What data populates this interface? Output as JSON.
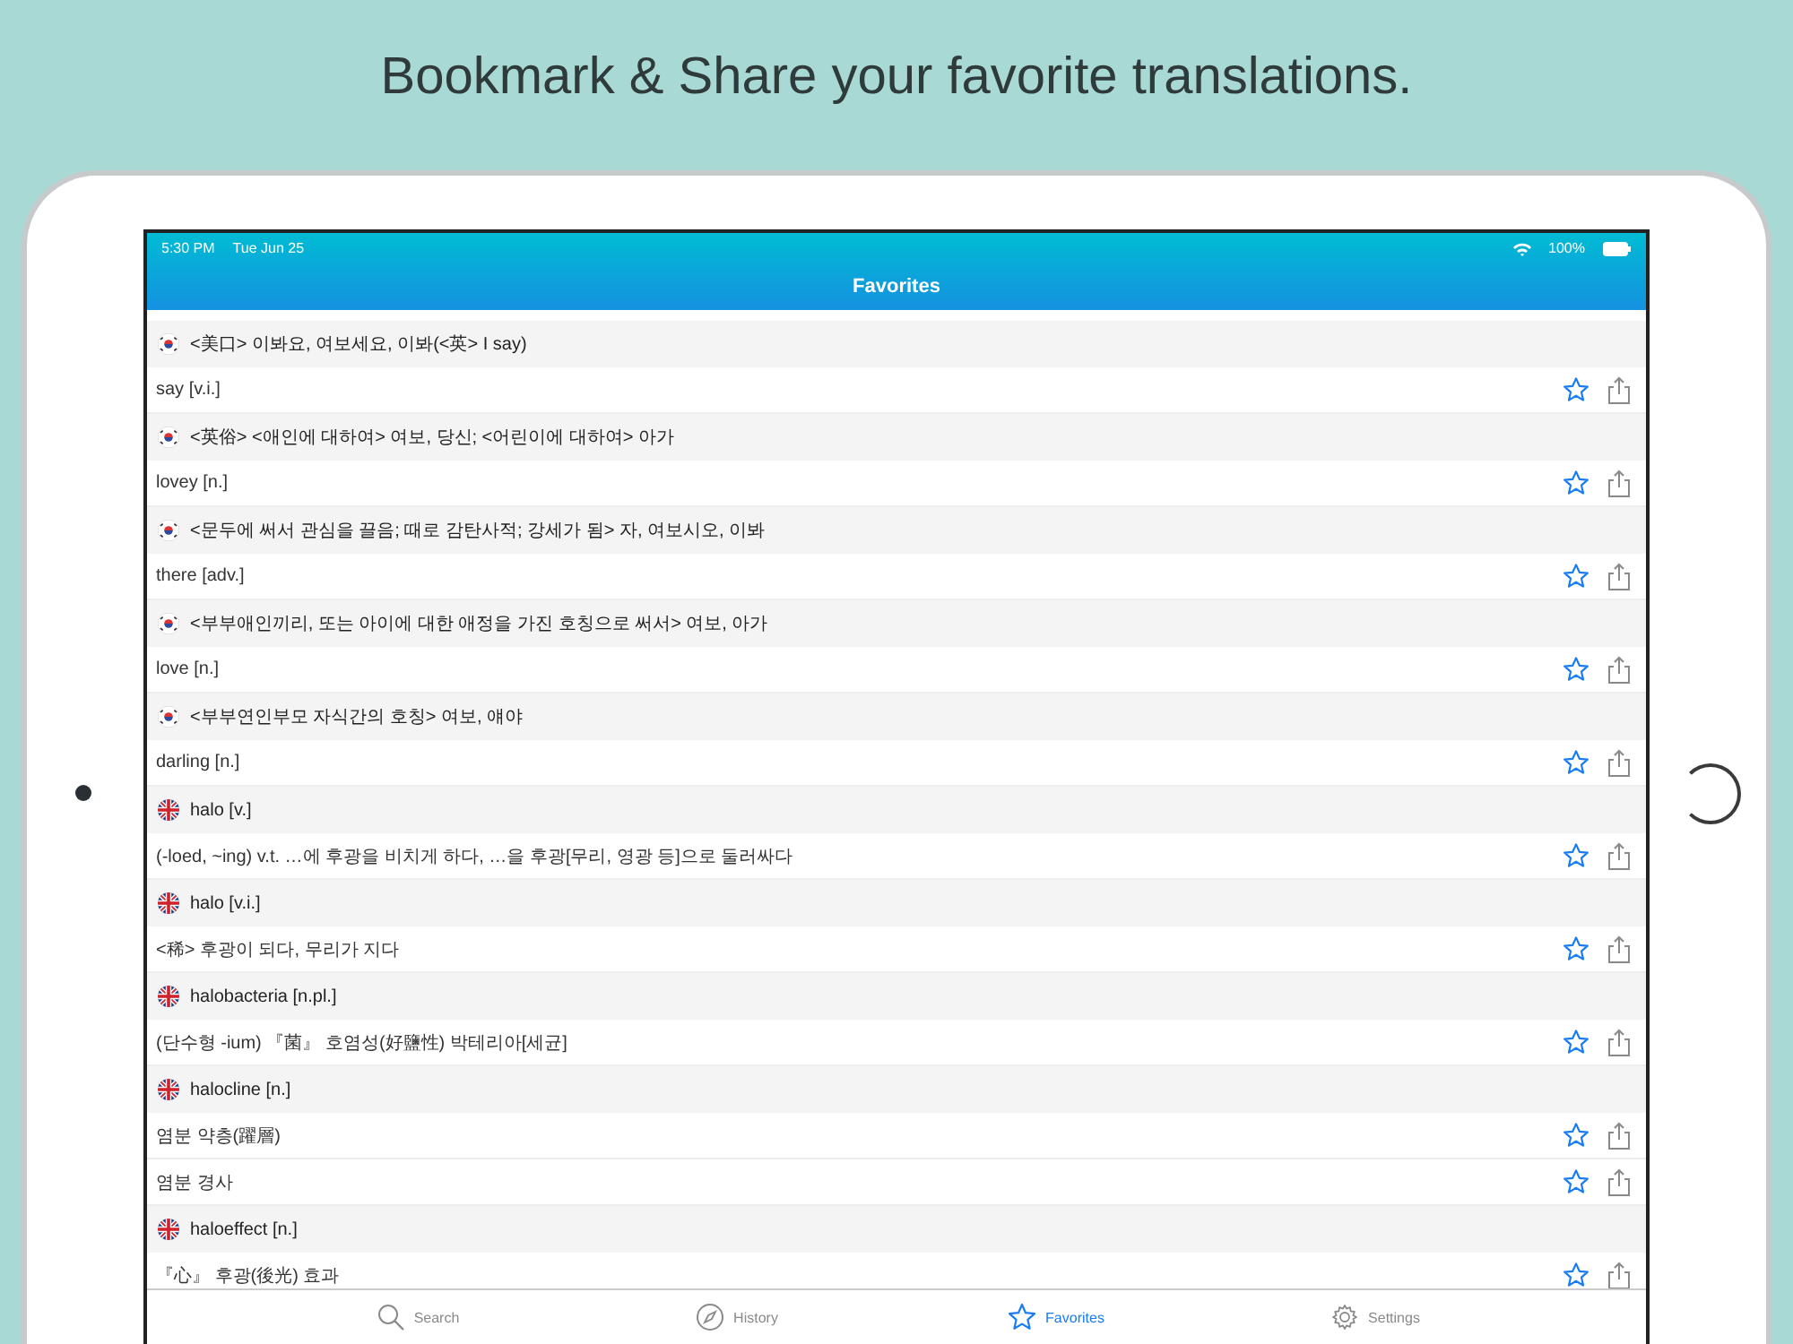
{
  "headline": "Bookmark & Share your favorite translations.",
  "status_bar": {
    "time": "5:30 PM",
    "date": "Tue Jun 25",
    "battery": "100%"
  },
  "nav_title": "Favorites",
  "groups": [
    {
      "kind": "korean",
      "heading": "<美口> 이봐요, 여보세요, 이봐(<英> I say)",
      "entries": [
        "say [v.i.]"
      ]
    },
    {
      "kind": "korean",
      "heading": "<英俗> <애인에 대하여> 여보, 당신; <어린이에 대하여> 아가",
      "entries": [
        "lovey [n.]"
      ]
    },
    {
      "kind": "korean",
      "heading": "<문두에 써서 관심을 끌음; 때로 감탄사적; 강세가 됨> 자, 여보시오, 이봐",
      "entries": [
        "there [adv.]"
      ]
    },
    {
      "kind": "korean",
      "heading": "<부부애인끼리, 또는 아이에 대한 애정을 가진 호칭으로 써서> 여보, 아가",
      "entries": [
        "love [n.]"
      ]
    },
    {
      "kind": "korean",
      "heading": "<부부연인부모 자식간의 호칭> 여보, 얘야",
      "entries": [
        "darling [n.]"
      ]
    },
    {
      "kind": "british",
      "heading": "halo [v.]",
      "entries": [
        "(-loed, ~ing) v.t. …에 후광을 비치게 하다, …을 후광[무리, 영광 등]으로 둘러싸다"
      ]
    },
    {
      "kind": "british",
      "heading": "halo [v.i.]",
      "entries": [
        "<稀> 후광이 되다, 무리가 지다"
      ]
    },
    {
      "kind": "british",
      "heading": "halobacteria [n.pl.]",
      "entries": [
        "(단수형 -ium) 『菌』 호염성(好鹽性) 박테리아[세균]"
      ]
    },
    {
      "kind": "british",
      "heading": "halocline [n.]",
      "entries": [
        "염분 약층(躍層)",
        "염분 경사"
      ]
    },
    {
      "kind": "british",
      "heading": "haloeffect [n.]",
      "entries": [
        "『心』 후광(後光) 효과"
      ]
    }
  ],
  "tabs": [
    {
      "kind": "search",
      "label": "Search",
      "selected": false
    },
    {
      "kind": "history",
      "label": "History",
      "selected": false
    },
    {
      "kind": "favorites",
      "label": "Favorites",
      "selected": true
    },
    {
      "kind": "settings",
      "label": "Settings",
      "selected": false
    }
  ]
}
